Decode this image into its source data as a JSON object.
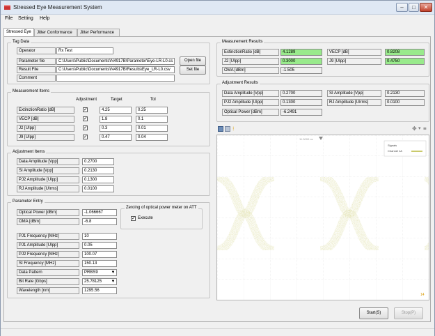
{
  "window": {
    "title": "Stressed Eye Measurement System",
    "min": "–",
    "max": "□",
    "close": "✕"
  },
  "menu": [
    "File",
    "Setting",
    "Help"
  ],
  "tabs": [
    "Stressed Eye",
    "Jitter Conformance",
    "Jitter Performance"
  ],
  "tag_data": {
    "title": "Tag Data",
    "operator_label": "Operator",
    "operator_value": "Rx Test",
    "param_label": "Parameter file",
    "param_value": "C:\\Users\\Public\\Documents\\N4917B\\Parameter\\Eye-LR-L0.cs",
    "result_label": "Result File",
    "result_value": "C:\\Users\\Public\\Documents\\N4917B\\Results\\Eye_LR-L0.csv",
    "comment_label": "Comment",
    "comment_value": "",
    "open_btn": "Open file",
    "set_btn": "Set file"
  },
  "meas_items": {
    "title": "Measurement Items",
    "col_adjust": "Adjustment",
    "col_target": "Target",
    "col_tol": "Tol",
    "rows": [
      {
        "label": "ExtinctionRatio [dB]",
        "target": "4.25",
        "tol": "0.25"
      },
      {
        "label": "VECP        [dB]",
        "target": "1.8",
        "tol": "0.1"
      },
      {
        "label": "J2            [UIpp]",
        "target": "0.3",
        "tol": "0.01"
      },
      {
        "label": "J9            [UIpp]",
        "target": "0.47",
        "tol": "0.04"
      }
    ]
  },
  "adj_items": {
    "title": "Adjustment Items",
    "rows": [
      {
        "label": "Data Amplitude [Vpp]",
        "value": "0.2700"
      },
      {
        "label": "SI Amplitude    [Vpp]",
        "value": "0.2130"
      },
      {
        "label": "PJ2 Amplitude [UIpp]",
        "value": "0.1300"
      },
      {
        "label": "RJ Amplitude  [UIrms]",
        "value": "0.0100"
      }
    ]
  },
  "param_entry": {
    "title": "Parameter Entry",
    "optical_label": "Optical Power [dBm]",
    "optical_value": "-1.066667",
    "oma_label": "OMA          [dBm]",
    "oma_value": "-6.8",
    "zeroing_title": "Zeroing of optical power meter on ATT",
    "execute_label": "Execute",
    "rows": [
      {
        "label": "PJ1 Frequency [MHz]",
        "value": "10"
      },
      {
        "label": "PJ1 Amplitude [UIpp]",
        "value": "0.05"
      },
      {
        "label": "PJ2 Frequency [MHz]",
        "value": "100.07"
      },
      {
        "label": "SI Frequency   [MHz]",
        "value": "150.13"
      }
    ],
    "pattern_label": "Data Pattern",
    "pattern_value": "PRBS9",
    "bitrate_label": "Bit Rate     [Gbps]",
    "bitrate_value": "25.78125",
    "wavelength_label": "Wavelength    [nm]",
    "wavelength_value": "1295.56"
  },
  "meas_results": {
    "title": "Measurement Results",
    "er_label": "ExtinctionRatio [dB]",
    "er_value": "4.1289",
    "vecp_label": "VECP  [dB]",
    "vecp_value": "0.8208",
    "j2_label": "J2              [UIpp]",
    "j2_value": "0.3000",
    "j9_label": "J9    [UIpp]",
    "j9_value": "0.4750",
    "oma_label": "OMA           [dBm]",
    "oma_value": "-1.505"
  },
  "adj_results": {
    "title": "Adjustment Results",
    "da_label": "Data Amplitude [Vpp]",
    "da_value": "0.2700",
    "si_label": "SI Amplitude   [Vpp]",
    "si_value": "0.2130",
    "pj2_label": "PJ2 Amplitude  [UIpp]",
    "pj2_value": "0.1300",
    "rj_label": "RJ Amplitude [UIrms]",
    "rj_value": "0.0100",
    "op_label": "Optical Power   [dBm]",
    "op_value": "-6.2491"
  },
  "scope": {
    "legend_title": "Signals",
    "legend_item": "Channel 1A",
    "marker_label": "11.0000 ns",
    "corner_label": "14",
    "trace_color": "#9c9c2e"
  },
  "buttons": {
    "start": "Start(S)",
    "stop": "Stop(P)"
  }
}
